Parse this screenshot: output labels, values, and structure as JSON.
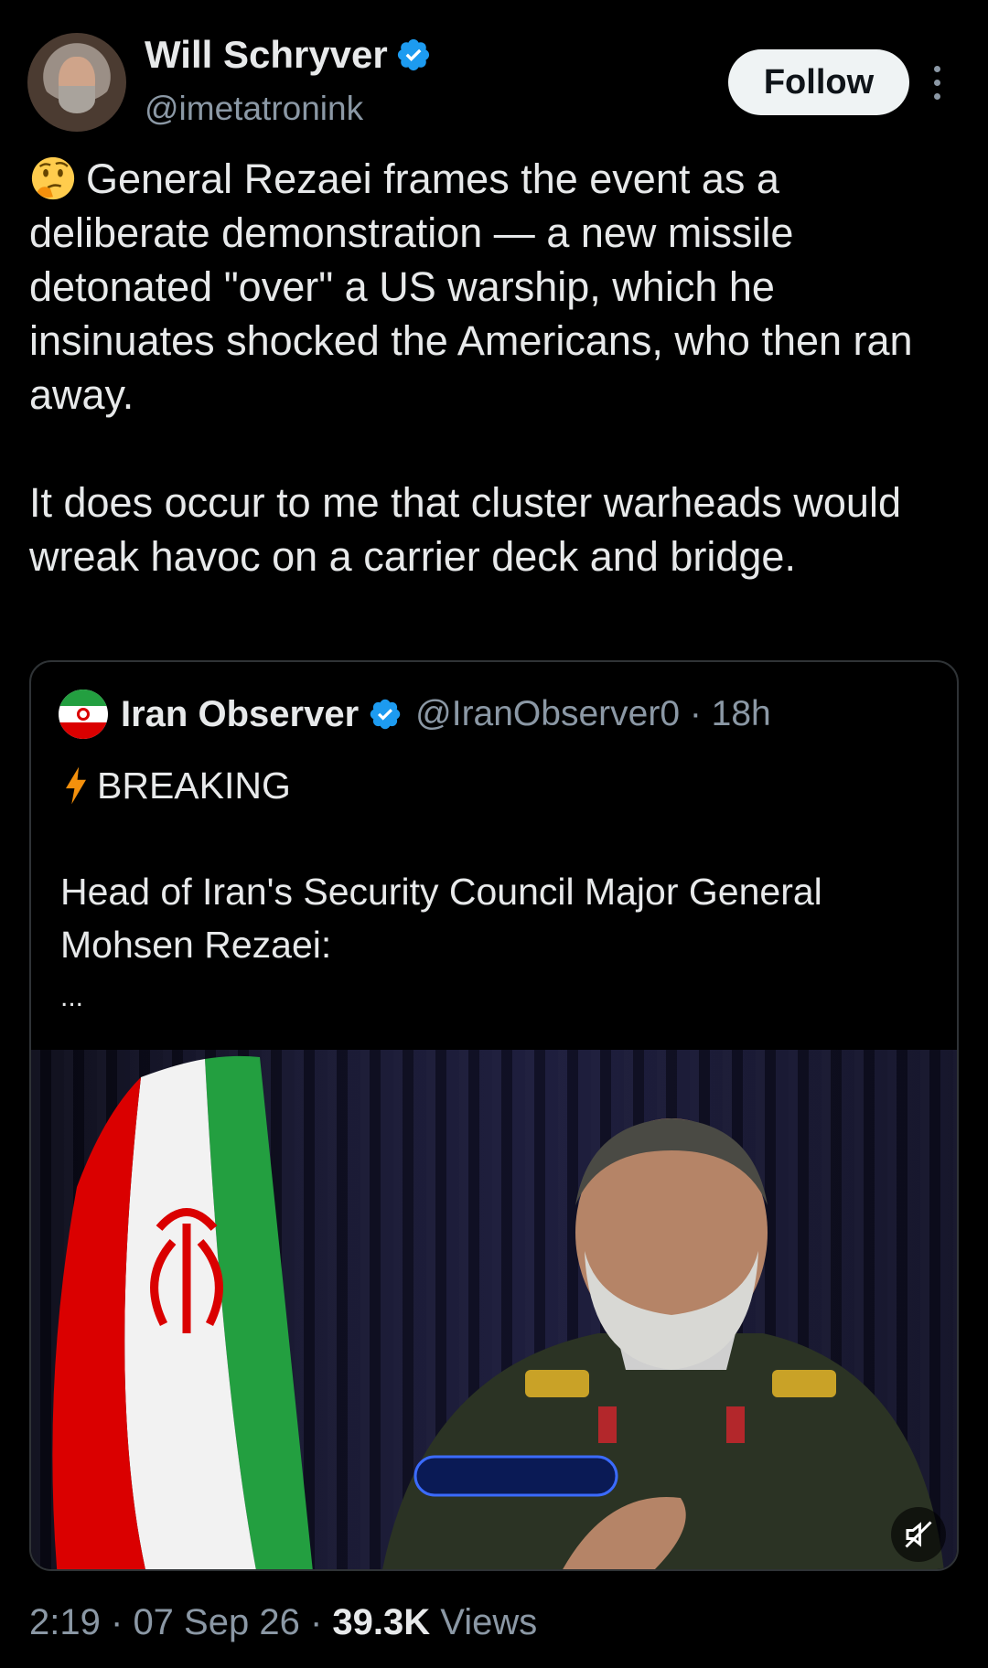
{
  "author": {
    "display_name": "Will Schryver",
    "handle": "@imetatronink",
    "verified": true
  },
  "actions": {
    "follow_label": "Follow",
    "more_icon": "more-vertical-icon"
  },
  "tweet": {
    "emoji": "thinking-face-icon",
    "paragraph1": "General Rezaei frames the event as a deliberate demonstration — a new missile detonated \"over\" a US warship, which he insinuates shocked the Americans, who then ran away.",
    "paragraph2": "It does occur to me that cluster warheads would wreak havoc on a carrier deck and bridge."
  },
  "quote": {
    "display_name": "Iran Observer",
    "handle_time": "@IranObserver0 · 18h",
    "verified": true,
    "line1": "BREAKING",
    "line2": "Head of Iran's Security Council Major General Mohsen Rezaei:",
    "ellipsis": "...",
    "media": {
      "type": "video",
      "muted": true
    }
  },
  "meta": {
    "time": "2:19",
    "date": "07 Sep 26",
    "views_count": "39.3K",
    "views_label": "Views",
    "sep": "·"
  },
  "colors": {
    "background": "#000000",
    "text": "#e7e9ea",
    "secondary": "#8b98a5",
    "verified": "#1d9bf0",
    "border": "#2f3336"
  }
}
